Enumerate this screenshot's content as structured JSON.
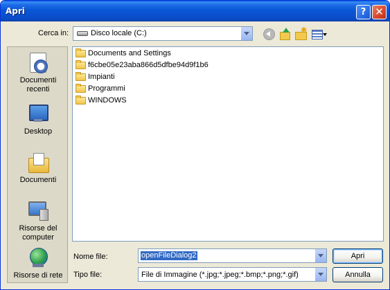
{
  "titlebar": {
    "title": "Apri",
    "help_glyph": "?",
    "close_glyph": "✕"
  },
  "toolbar": {
    "look_in_label": "Cerca in:",
    "look_in_value": "Disco locale (C:)"
  },
  "places": [
    {
      "label": "Documenti recenti",
      "icon": "recent-documents-icon"
    },
    {
      "label": "Desktop",
      "icon": "desktop-icon"
    },
    {
      "label": "Documenti",
      "icon": "documents-icon"
    },
    {
      "label": "Risorse del computer",
      "icon": "computer-icon"
    },
    {
      "label": "Risorse di rete",
      "icon": "network-icon"
    }
  ],
  "files": [
    {
      "name": "Documents and Settings",
      "type": "folder"
    },
    {
      "name": "f6cbe05e23aba866d5dfbe94d9f1b6",
      "type": "folder"
    },
    {
      "name": "Impianti",
      "type": "folder"
    },
    {
      "name": "Programmi",
      "type": "folder"
    },
    {
      "name": "WINDOWS",
      "type": "folder"
    }
  ],
  "form": {
    "file_name_label": "Nome file:",
    "file_name_value": "openFileDialog2",
    "file_type_label": "Tipo file:",
    "file_type_value": "File di Immagine (*.jpg;*.jpeg;*.bmp;*.png;*.gif)"
  },
  "buttons": {
    "open_label": "Apri",
    "cancel_label": "Annulla"
  },
  "colors": {
    "titlebar": "#0a57d6",
    "dialog_bg": "#ece9d8",
    "selection": "#316ac5"
  }
}
